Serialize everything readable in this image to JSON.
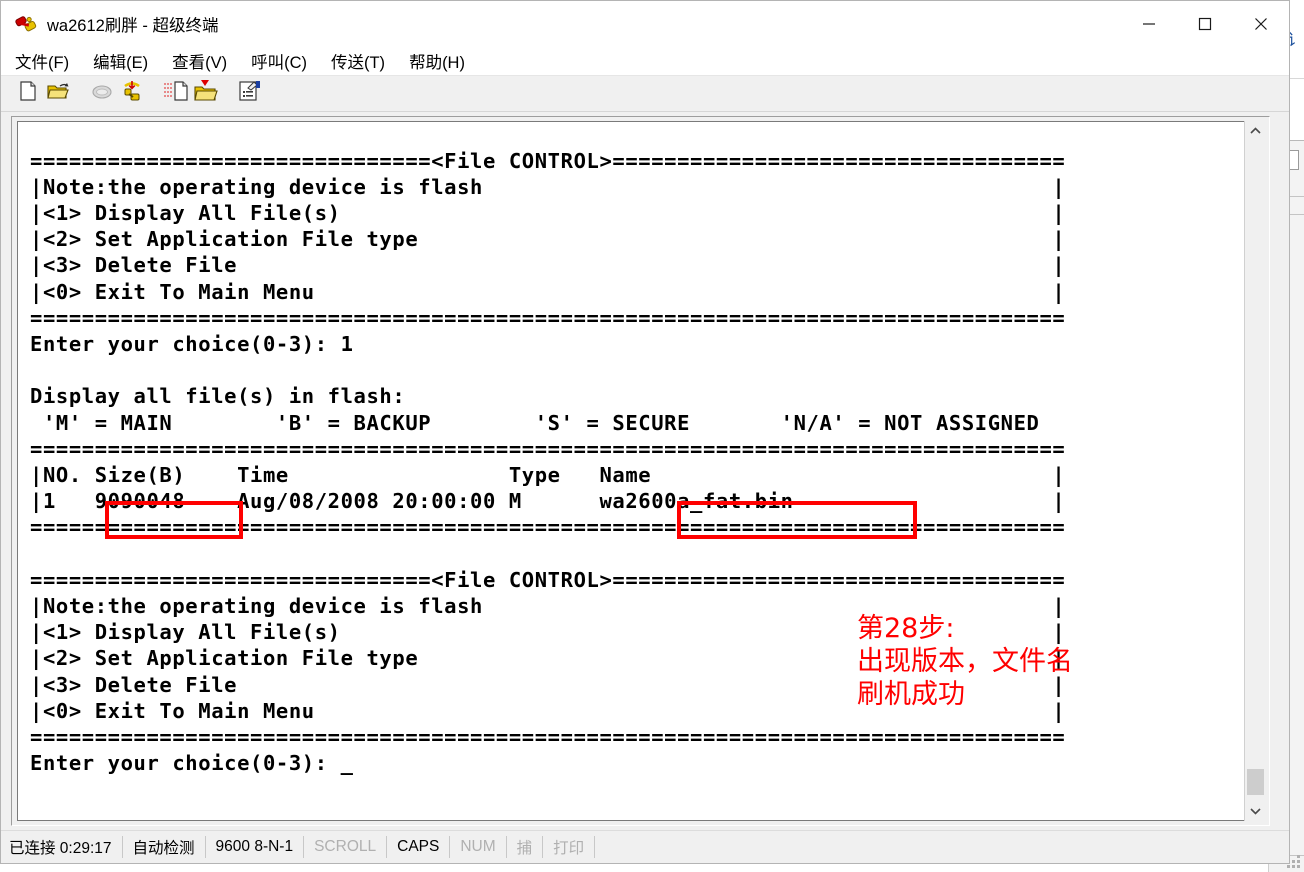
{
  "window": {
    "title": "wa2612刷胖 - 超级终端",
    "icon": "hyperterminal-phone-icon",
    "minimize_label": "—",
    "maximize_label": "□",
    "close_label": "✕"
  },
  "menubar": {
    "items": [
      {
        "label": "文件(F)",
        "name": "menu-file"
      },
      {
        "label": "编辑(E)",
        "name": "menu-edit"
      },
      {
        "label": "查看(V)",
        "name": "menu-view"
      },
      {
        "label": "呼叫(C)",
        "name": "menu-call"
      },
      {
        "label": "传送(T)",
        "name": "menu-transfer"
      },
      {
        "label": "帮助(H)",
        "name": "menu-help"
      }
    ]
  },
  "toolbar": {
    "buttons": [
      {
        "name": "new-connection-icon",
        "icon": "page-icon"
      },
      {
        "name": "open-connection-icon",
        "icon": "folder-open-icon"
      },
      {
        "name": "disconnect-icon",
        "icon": "phone-hangup-icon"
      },
      {
        "name": "connect-icon",
        "icon": "phone-call-icon"
      },
      {
        "name": "send-file-icon",
        "icon": "send-page-icon"
      },
      {
        "name": "receive-file-icon",
        "icon": "receive-folder-icon"
      },
      {
        "name": "properties-icon",
        "icon": "properties-icon"
      }
    ]
  },
  "terminal": {
    "content": "===============================<File CONTROL>===================================\n|Note:the operating device is flash                                            |\n|<1> Display All File(s)                                                       |\n|<2> Set Application File type                                                 |\n|<3> Delete File                                                               |\n|<0> Exit To Main Menu                                                         |\n================================================================================\nEnter your choice(0-3): 1\n\nDisplay all file(s) in flash:\n 'M' = MAIN        'B' = BACKUP        'S' = SECURE       'N/A' = NOT ASSIGNED\n================================================================================\n|NO. Size(B)    Time                 Type   Name                               |\n|1   9090048    Aug/08/2008 20:00:00 M      wa2600a_fat.bin                    |\n================================================================================\n\n===============================<File CONTROL>===================================\n|Note:the operating device is flash                                            |\n|<1> Display All File(s)                                                       |\n|<2> Set Application File type                                                 |\n|<3> Delete File                                                               |\n|<0> Exit To Main Menu                                                         |\n================================================================================\nEnter your choice(0-3): _",
    "scrollbar": {
      "up_arrow": "︿",
      "down_arrow": "﹀"
    }
  },
  "annotations": {
    "accent_color": "#ff0000",
    "highlighted_size": "9090048",
    "highlighted_filename": "wa2600a_fat.bin",
    "note_text": "第28步:\n出现版本，文件名\n刷机成功"
  },
  "statusbar": {
    "cells": [
      {
        "label": "已连接 0:29:17",
        "dim": false,
        "name": "status-connected-time"
      },
      {
        "label": "自动检测",
        "dim": false,
        "name": "status-autodetect"
      },
      {
        "label": "9600 8-N-1",
        "dim": false,
        "name": "status-port-settings"
      },
      {
        "label": "SCROLL",
        "dim": true,
        "name": "status-scroll"
      },
      {
        "label": "CAPS",
        "dim": false,
        "name": "status-caps"
      },
      {
        "label": "NUM",
        "dim": true,
        "name": "status-num"
      },
      {
        "label": "捕",
        "dim": true,
        "name": "status-capture"
      },
      {
        "label": "打印",
        "dim": true,
        "name": "status-print"
      }
    ]
  },
  "background_window": {
    "glyph": "鼠讠"
  }
}
